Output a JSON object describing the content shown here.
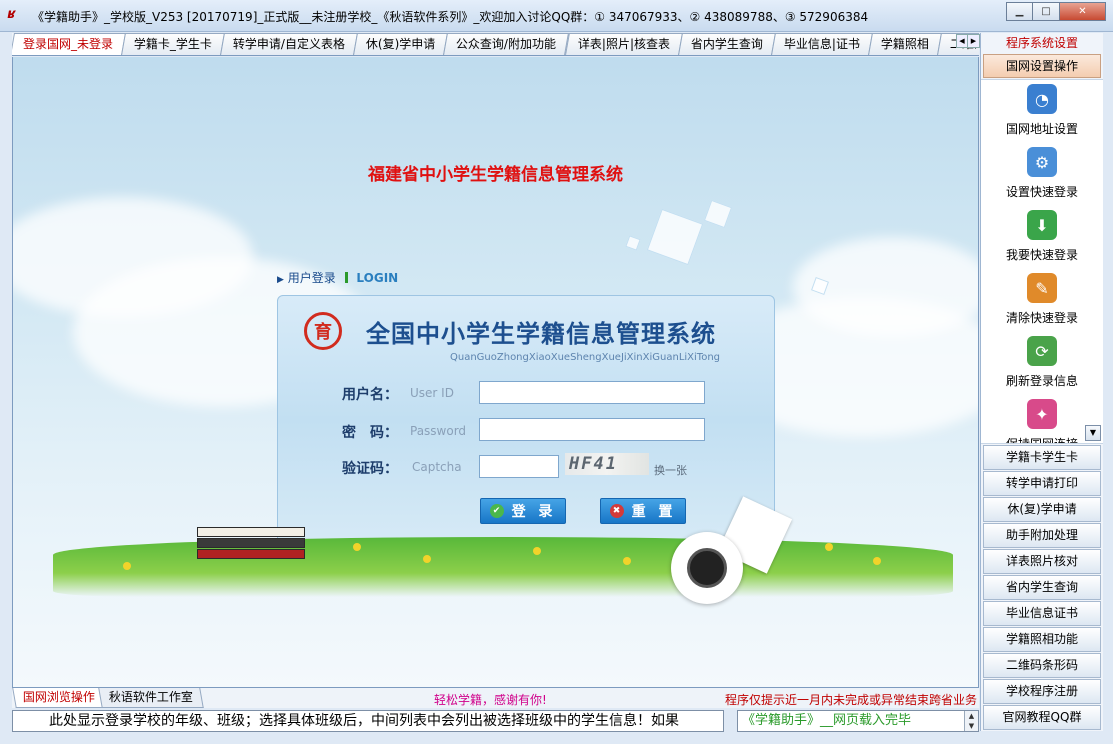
{
  "window": {
    "title": "《学籍助手》_学校版_V253 [20170719]_正式版__未注册学校_《秋语软件系列》_欢迎加入讨论QQ群：① 347067933、② 438089788、③ 572906384",
    "min": "▁",
    "max": "□",
    "close": "✕"
  },
  "tabs": [
    {
      "label": "登录国网_未登录",
      "active": true
    },
    {
      "label": "学籍卡_学生卡"
    },
    {
      "label": "转学申请/自定义表格"
    },
    {
      "label": "休(复)学申请"
    },
    {
      "label": "公众查询/附加功能"
    },
    {
      "label": "详表|照片|核查表"
    },
    {
      "label": "省内学生查询"
    },
    {
      "label": "毕业信息|证书"
    },
    {
      "label": "学籍照相"
    },
    {
      "label": "二维码"
    }
  ],
  "tab_nav": {
    "prev": "◀",
    "next": "▶"
  },
  "login": {
    "page_title": "福建省中小学生学籍信息管理系统",
    "section_label": "用户登录",
    "section_label_en": "LOGIN",
    "logo_char": "育",
    "system_name": "全国中小学生学籍信息管理系统",
    "system_pinyin": "QuanGuoZhongXiaoXueShengXueJiXinXiGuanLiXiTong",
    "username_label": "用户名：",
    "username_hint": "User ID",
    "username_value": "",
    "password_label": "密　码：",
    "password_hint": "Password",
    "password_value": "",
    "captcha_label": "验证码：",
    "captcha_hint": "Captcha",
    "captcha_value": "",
    "captcha_image_text": "HF41",
    "captcha_refresh": "换一张",
    "login_button": "登 录",
    "reset_button": "重 置"
  },
  "right_panel": {
    "header": "程序系统设置",
    "active_item": "国网设置操作",
    "items": [
      {
        "label": "国网地址设置",
        "icon": "web-globe-icon",
        "color": "#3a7fd0"
      },
      {
        "label": "设置快速登录",
        "icon": "gears-globe-icon",
        "color": "#4a8fd8"
      },
      {
        "label": "我要快速登录",
        "icon": "download-globe-icon",
        "color": "#3aa54a"
      },
      {
        "label": "清除快速登录",
        "icon": "eraser-icon",
        "color": "#e08a2a"
      },
      {
        "label": "刷新登录信息",
        "icon": "refresh-globe-icon",
        "color": "#4aa34a"
      },
      {
        "label": "保持国网连接",
        "icon": "connect-icon",
        "color": "#d84a8a"
      }
    ],
    "scroll_down": "▼",
    "buttons": [
      "学籍卡学生卡",
      "转学申请打印",
      "休(复)学申请",
      "助手附加处理",
      "详表照片核对",
      "省内学生查询",
      "毕业信息证书",
      "学籍照相功能",
      "二维码条形码",
      "学校程序注册",
      "官网教程QQ群"
    ]
  },
  "bottom_tabs": [
    {
      "label": "国网浏览操作",
      "active": true
    },
    {
      "label": "秋语软件工作室"
    }
  ],
  "bottom_center": "轻松学籍，感谢有你!",
  "bottom_right": "程序仅提示近一月内未完成或异常结束跨省业务",
  "status": {
    "main": "此处显示登录学校的年级、班级；选择具体班级后，中间列表中会列出被选择班级中的学生信息！如果",
    "side": "《学籍助手》__网页载入完毕",
    "spin_up": "▲",
    "spin_down": "▼"
  }
}
